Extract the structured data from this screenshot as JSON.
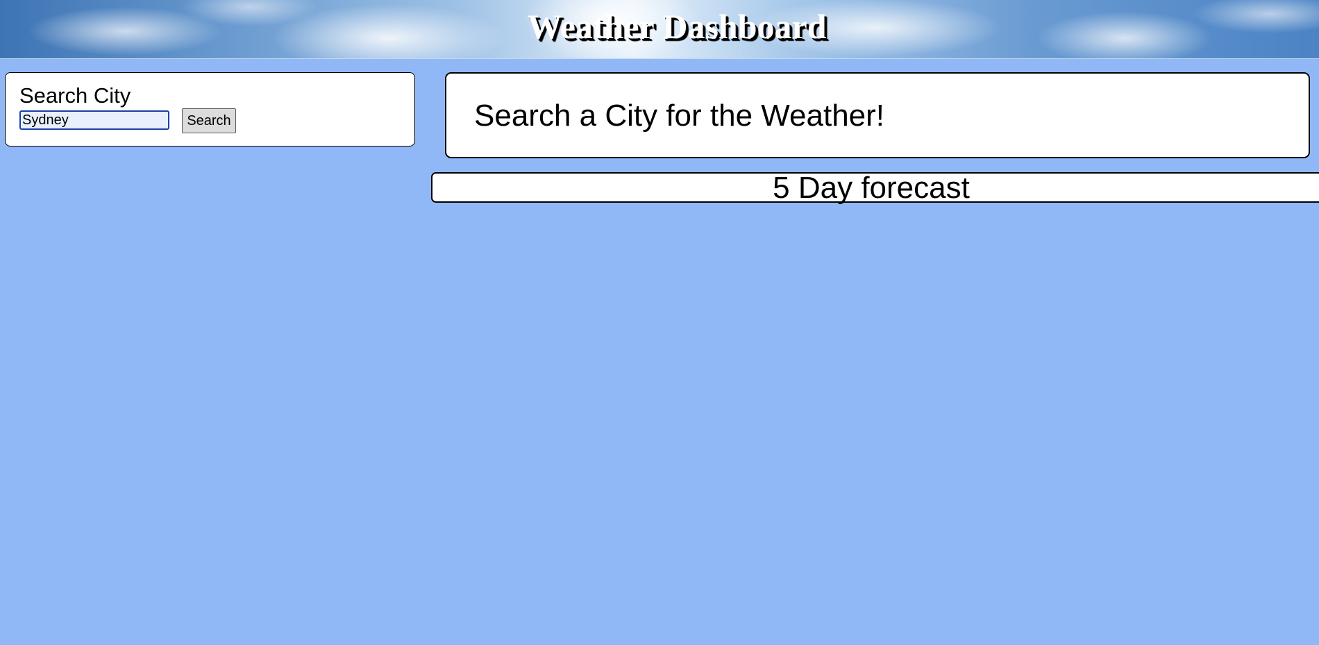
{
  "header": {
    "title": "Weather Dashboard"
  },
  "search": {
    "label": "Search City",
    "input_value": "Sydney",
    "button_label": "Search"
  },
  "current": {
    "message": "Search a City for the Weather!"
  },
  "forecast": {
    "title": "5 Day forecast"
  },
  "colors": {
    "page_background": "#91b8f6",
    "panel_background": "#ffffff",
    "input_focus_border": "#1a3fa8",
    "input_background": "#e8f0fe"
  }
}
